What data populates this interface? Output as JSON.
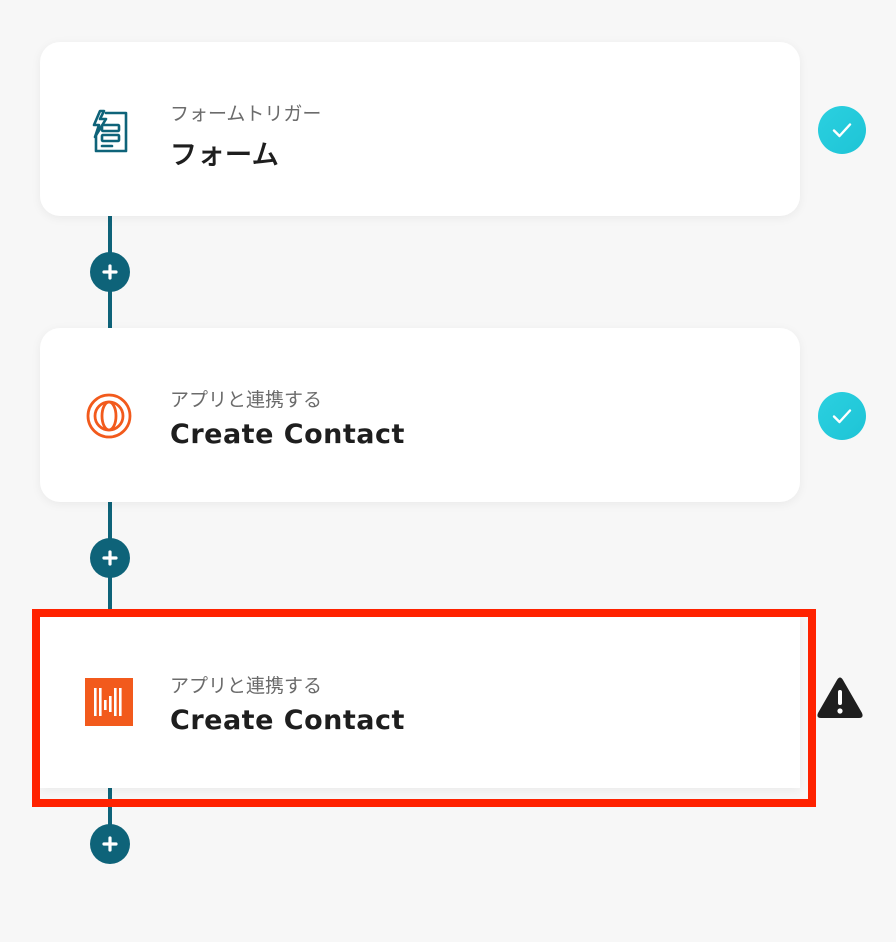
{
  "steps": [
    {
      "subtitle": "フォームトリガー",
      "title": "フォーム",
      "icon": "form-trigger-icon",
      "status": "completed"
    },
    {
      "subtitle": "アプリと連携する",
      "title": "Create Contact",
      "icon": "orange-rings-app-icon",
      "status": "completed"
    },
    {
      "subtitle": "アプリと連携する",
      "title": "Create Contact",
      "icon": "orange-bars-app-icon",
      "status": "warning"
    }
  ],
  "colors": {
    "connector": "#0e6379",
    "check": "#22c8da",
    "highlight": "#ff2200",
    "warning": "#1e1e1e",
    "app_orange": "#f25a1c"
  }
}
